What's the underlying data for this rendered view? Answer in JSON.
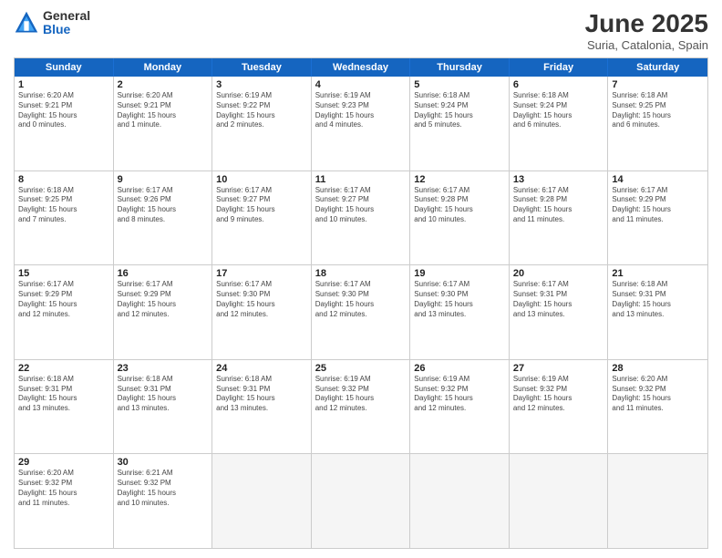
{
  "logo": {
    "general": "General",
    "blue": "Blue"
  },
  "title": {
    "month": "June 2025",
    "location": "Suria, Catalonia, Spain"
  },
  "header_days": [
    "Sunday",
    "Monday",
    "Tuesday",
    "Wednesday",
    "Thursday",
    "Friday",
    "Saturday"
  ],
  "rows": [
    [
      {
        "day": "1",
        "lines": [
          "Sunrise: 6:20 AM",
          "Sunset: 9:21 PM",
          "Daylight: 15 hours",
          "and 0 minutes."
        ]
      },
      {
        "day": "2",
        "lines": [
          "Sunrise: 6:20 AM",
          "Sunset: 9:21 PM",
          "Daylight: 15 hours",
          "and 1 minute."
        ]
      },
      {
        "day": "3",
        "lines": [
          "Sunrise: 6:19 AM",
          "Sunset: 9:22 PM",
          "Daylight: 15 hours",
          "and 2 minutes."
        ]
      },
      {
        "day": "4",
        "lines": [
          "Sunrise: 6:19 AM",
          "Sunset: 9:23 PM",
          "Daylight: 15 hours",
          "and 4 minutes."
        ]
      },
      {
        "day": "5",
        "lines": [
          "Sunrise: 6:18 AM",
          "Sunset: 9:24 PM",
          "Daylight: 15 hours",
          "and 5 minutes."
        ]
      },
      {
        "day": "6",
        "lines": [
          "Sunrise: 6:18 AM",
          "Sunset: 9:24 PM",
          "Daylight: 15 hours",
          "and 6 minutes."
        ]
      },
      {
        "day": "7",
        "lines": [
          "Sunrise: 6:18 AM",
          "Sunset: 9:25 PM",
          "Daylight: 15 hours",
          "and 6 minutes."
        ]
      }
    ],
    [
      {
        "day": "8",
        "lines": [
          "Sunrise: 6:18 AM",
          "Sunset: 9:25 PM",
          "Daylight: 15 hours",
          "and 7 minutes."
        ]
      },
      {
        "day": "9",
        "lines": [
          "Sunrise: 6:17 AM",
          "Sunset: 9:26 PM",
          "Daylight: 15 hours",
          "and 8 minutes."
        ]
      },
      {
        "day": "10",
        "lines": [
          "Sunrise: 6:17 AM",
          "Sunset: 9:27 PM",
          "Daylight: 15 hours",
          "and 9 minutes."
        ]
      },
      {
        "day": "11",
        "lines": [
          "Sunrise: 6:17 AM",
          "Sunset: 9:27 PM",
          "Daylight: 15 hours",
          "and 10 minutes."
        ]
      },
      {
        "day": "12",
        "lines": [
          "Sunrise: 6:17 AM",
          "Sunset: 9:28 PM",
          "Daylight: 15 hours",
          "and 10 minutes."
        ]
      },
      {
        "day": "13",
        "lines": [
          "Sunrise: 6:17 AM",
          "Sunset: 9:28 PM",
          "Daylight: 15 hours",
          "and 11 minutes."
        ]
      },
      {
        "day": "14",
        "lines": [
          "Sunrise: 6:17 AM",
          "Sunset: 9:29 PM",
          "Daylight: 15 hours",
          "and 11 minutes."
        ]
      }
    ],
    [
      {
        "day": "15",
        "lines": [
          "Sunrise: 6:17 AM",
          "Sunset: 9:29 PM",
          "Daylight: 15 hours",
          "and 12 minutes."
        ]
      },
      {
        "day": "16",
        "lines": [
          "Sunrise: 6:17 AM",
          "Sunset: 9:29 PM",
          "Daylight: 15 hours",
          "and 12 minutes."
        ]
      },
      {
        "day": "17",
        "lines": [
          "Sunrise: 6:17 AM",
          "Sunset: 9:30 PM",
          "Daylight: 15 hours",
          "and 12 minutes."
        ]
      },
      {
        "day": "18",
        "lines": [
          "Sunrise: 6:17 AM",
          "Sunset: 9:30 PM",
          "Daylight: 15 hours",
          "and 12 minutes."
        ]
      },
      {
        "day": "19",
        "lines": [
          "Sunrise: 6:17 AM",
          "Sunset: 9:30 PM",
          "Daylight: 15 hours",
          "and 13 minutes."
        ]
      },
      {
        "day": "20",
        "lines": [
          "Sunrise: 6:17 AM",
          "Sunset: 9:31 PM",
          "Daylight: 15 hours",
          "and 13 minutes."
        ]
      },
      {
        "day": "21",
        "lines": [
          "Sunrise: 6:18 AM",
          "Sunset: 9:31 PM",
          "Daylight: 15 hours",
          "and 13 minutes."
        ]
      }
    ],
    [
      {
        "day": "22",
        "lines": [
          "Sunrise: 6:18 AM",
          "Sunset: 9:31 PM",
          "Daylight: 15 hours",
          "and 13 minutes."
        ]
      },
      {
        "day": "23",
        "lines": [
          "Sunrise: 6:18 AM",
          "Sunset: 9:31 PM",
          "Daylight: 15 hours",
          "and 13 minutes."
        ]
      },
      {
        "day": "24",
        "lines": [
          "Sunrise: 6:18 AM",
          "Sunset: 9:31 PM",
          "Daylight: 15 hours",
          "and 13 minutes."
        ]
      },
      {
        "day": "25",
        "lines": [
          "Sunrise: 6:19 AM",
          "Sunset: 9:32 PM",
          "Daylight: 15 hours",
          "and 12 minutes."
        ]
      },
      {
        "day": "26",
        "lines": [
          "Sunrise: 6:19 AM",
          "Sunset: 9:32 PM",
          "Daylight: 15 hours",
          "and 12 minutes."
        ]
      },
      {
        "day": "27",
        "lines": [
          "Sunrise: 6:19 AM",
          "Sunset: 9:32 PM",
          "Daylight: 15 hours",
          "and 12 minutes."
        ]
      },
      {
        "day": "28",
        "lines": [
          "Sunrise: 6:20 AM",
          "Sunset: 9:32 PM",
          "Daylight: 15 hours",
          "and 11 minutes."
        ]
      }
    ],
    [
      {
        "day": "29",
        "lines": [
          "Sunrise: 6:20 AM",
          "Sunset: 9:32 PM",
          "Daylight: 15 hours",
          "and 11 minutes."
        ]
      },
      {
        "day": "30",
        "lines": [
          "Sunrise: 6:21 AM",
          "Sunset: 9:32 PM",
          "Daylight: 15 hours",
          "and 10 minutes."
        ]
      },
      {
        "day": "",
        "lines": []
      },
      {
        "day": "",
        "lines": []
      },
      {
        "day": "",
        "lines": []
      },
      {
        "day": "",
        "lines": []
      },
      {
        "day": "",
        "lines": []
      }
    ]
  ]
}
